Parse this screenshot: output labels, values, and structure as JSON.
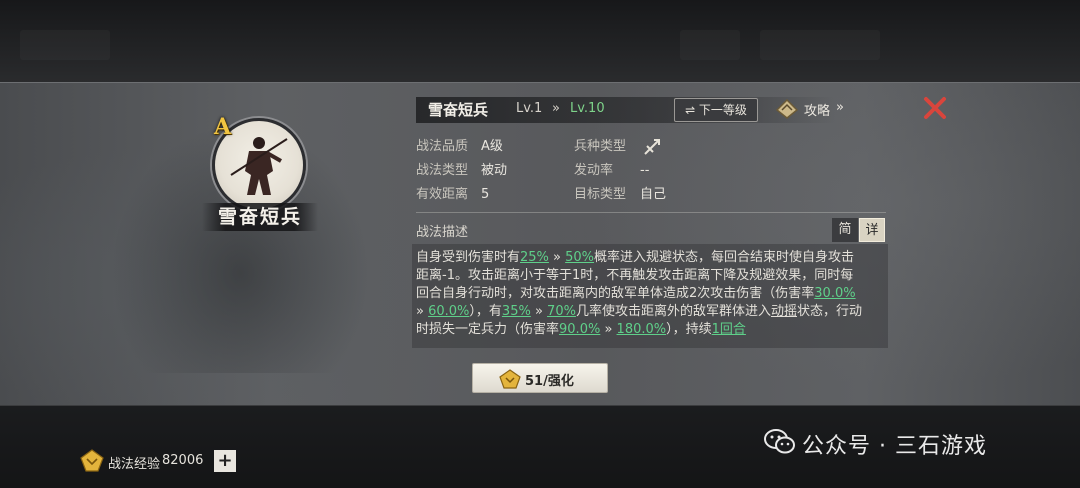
{
  "skill": {
    "grade_badge": "A",
    "portrait_name": "雪奋短兵",
    "name": "雪奋短兵",
    "level_current": "Lv.1",
    "level_arrow": "»",
    "level_max": "Lv.10",
    "next_level_button": "⇌ 下一等级",
    "guide_label": "攻略",
    "guide_arrow": "»"
  },
  "info": {
    "quality_label": "战法品质",
    "quality_value": "A级",
    "type_label": "战法类型",
    "type_value": "被动",
    "range_label": "有效距离",
    "range_value": "5",
    "troop_label": "兵种类型",
    "trigger_label": "发动率",
    "trigger_value": "--",
    "target_label": "目标类型",
    "target_value": "自己"
  },
  "description": {
    "title": "战法描述",
    "tab_simple": "简",
    "tab_detail": "详",
    "l1_a": "自身受到伤害时有",
    "l1_g1": "25%",
    "l1_arrow": " » ",
    "l1_g2": "50%",
    "l1_b": "概率进入规避状态，每回合结束时使自身攻击",
    "l2": "距离-1。攻击距离小于等于1时，不再触发攻击距离下降及规避效果，同时每",
    "l3_a": "回合自身行动时，对攻击距离内的敌军单体造成2次攻击伤害（伤害率",
    "l3_g": "30.0%",
    "l4_arrow1": "» ",
    "l4_g1": "60.0%",
    "l4_a": "），有",
    "l4_g2": "35%",
    "l4_arrow2": " » ",
    "l4_g3": "70%",
    "l4_b": "几率使攻击距离外的敌军群体进入",
    "l4_u": "动摇",
    "l4_c": "状态，行动",
    "l5_a": "时损失一定兵力（伤害率",
    "l5_g1": "90.0%",
    "l5_arrow": " » ",
    "l5_g2": "180.0%",
    "l5_b": "），持续",
    "l5_g3": "1回合"
  },
  "upgrade_button": "51/强化",
  "footer": {
    "exp_label": "战法经验",
    "exp_value": "82006",
    "plus": "+"
  },
  "watermark": "公众号 · 三石游戏",
  "colors": {
    "highlight_green": "#5fd08a",
    "grade_gold": "#f1c542",
    "close_red": "#d9453c"
  },
  "icons": [
    "troop-type-icon",
    "guide-scroll-icon",
    "close-icon",
    "enhance-coin-icon",
    "exp-coin-icon",
    "wechat-icon"
  ]
}
